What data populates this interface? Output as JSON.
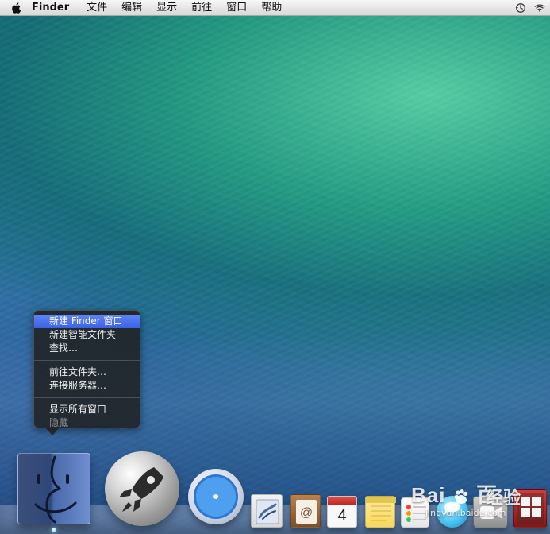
{
  "menubar": {
    "app_name": "Finder",
    "menus": [
      "文件",
      "编辑",
      "显示",
      "前往",
      "窗口",
      "帮助"
    ],
    "icons": {
      "apple": "apple-logo-icon",
      "time_machine": "time-machine-icon",
      "wifi": "wifi-icon"
    }
  },
  "context_menu": {
    "items": [
      {
        "label": "新建 Finder 窗口",
        "state": "selected"
      },
      {
        "label": "新建智能文件夹",
        "state": "enabled"
      },
      {
        "label": "查找…",
        "state": "enabled"
      },
      {
        "label": "前往文件夹…",
        "state": "enabled"
      },
      {
        "label": "连接服务器…",
        "state": "enabled"
      },
      {
        "label": "显示所有窗口",
        "state": "enabled"
      },
      {
        "label": "隐藏",
        "state": "disabled"
      }
    ],
    "colors": {
      "highlight": "#3b62e6",
      "background": "#202020"
    }
  },
  "dock": {
    "apps": [
      {
        "name": "Finder",
        "icon": "finder-icon"
      },
      {
        "name": "Launchpad",
        "icon": "launchpad-rocket-icon"
      },
      {
        "name": "Safari",
        "icon": "safari-compass-icon"
      },
      {
        "name": "Mail",
        "icon": "mail-stamp-icon"
      },
      {
        "name": "Contacts",
        "icon": "contacts-icon"
      },
      {
        "name": "Calendar",
        "icon": "calendar-icon"
      },
      {
        "name": "Notes",
        "icon": "notes-icon"
      },
      {
        "name": "Reminders",
        "icon": "reminders-icon"
      },
      {
        "name": "Messages",
        "icon": "messages-icon"
      },
      {
        "name": "FaceTime",
        "icon": "facetime-icon"
      },
      {
        "name": "Photo Booth",
        "icon": "photo-booth-icon"
      }
    ],
    "calendar_day": "4"
  },
  "watermark": {
    "brand": "Bai",
    "brand2": "百",
    "text": "经验",
    "url": "jingyan.baidu.com",
    "icon": "baidu-paw-icon"
  }
}
